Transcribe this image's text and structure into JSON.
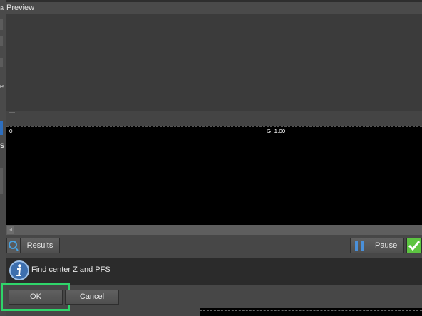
{
  "dialog": {
    "title": "Preview"
  },
  "left_strip": {
    "chars": [
      "a",
      "e",
      "S"
    ]
  },
  "histogram": {
    "left_label": "0",
    "gamma_label": "G: 1.00"
  },
  "toolbar": {
    "results_label": "Results",
    "pause_label": "Pause"
  },
  "message": {
    "text": "Find center Z and PFS"
  },
  "buttons": {
    "ok_label": "OK",
    "cancel_label": "Cancel"
  },
  "colors": {
    "highlight": "#2fd56a",
    "check_green": "#5cc441",
    "pause_blue": "#4a90d9"
  }
}
